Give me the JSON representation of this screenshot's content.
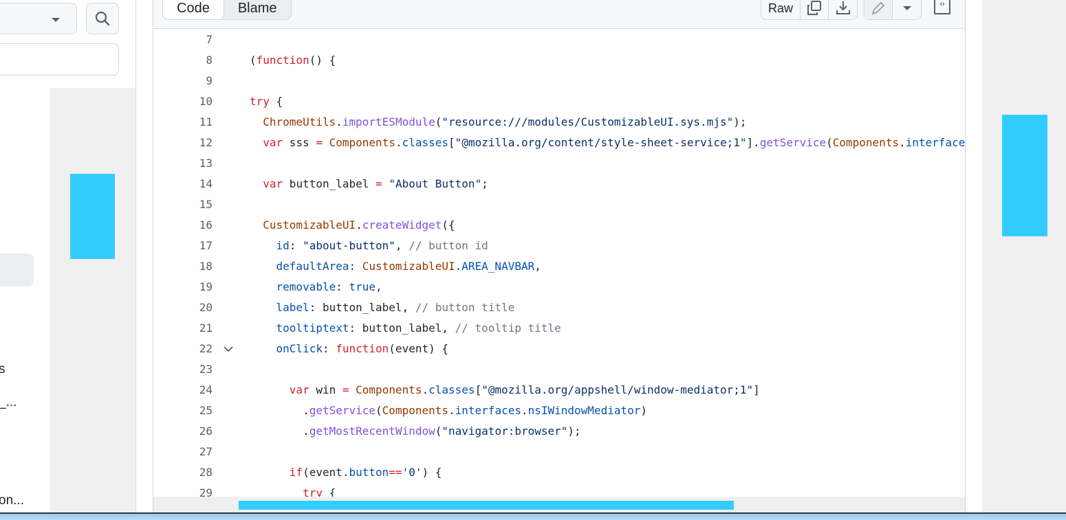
{
  "sidebar": {
    "truncated_items": [
      "s",
      "_...",
      "on..."
    ]
  },
  "tabs": [
    {
      "label": "Code",
      "active": true
    },
    {
      "label": "Blame",
      "active": false
    }
  ],
  "toolbar": {
    "raw_label": "Raw"
  },
  "colors": {
    "accent_overlay": "#33ccff",
    "keyword": "#cf222e",
    "entity": "#953800",
    "function": "#8250df",
    "constant": "#0550ae",
    "string": "#0a3069",
    "comment": "#6e7781"
  },
  "code": {
    "folded_line": 22,
    "lines": [
      {
        "n": "7",
        "t": []
      },
      {
        "n": "8",
        "t": [
          [
            "(",
            ""
          ],
          [
            "function",
            "k"
          ],
          [
            "() {",
            ""
          ]
        ]
      },
      {
        "n": "9",
        "t": []
      },
      {
        "n": "10",
        "t": [
          [
            "try",
            "k"
          ],
          [
            " {",
            ""
          ]
        ]
      },
      {
        "n": "11",
        "t": [
          [
            "  ",
            ""
          ],
          [
            "ChromeUtils",
            "e"
          ],
          [
            ".",
            ""
          ],
          [
            "importESModule",
            "f"
          ],
          [
            "(",
            ""
          ],
          [
            "\"resource:///modules/CustomizableUI.sys.mjs\"",
            "s"
          ],
          [
            ");",
            ""
          ]
        ]
      },
      {
        "n": "12",
        "t": [
          [
            "  ",
            ""
          ],
          [
            "var",
            "k"
          ],
          [
            " sss ",
            ""
          ],
          [
            "=",
            "k"
          ],
          [
            " ",
            ""
          ],
          [
            "Components",
            "e"
          ],
          [
            ".",
            ""
          ],
          [
            "classes",
            "c"
          ],
          [
            "[",
            ""
          ],
          [
            "\"@mozilla.org/content/style-sheet-service;1\"",
            "s"
          ],
          [
            "].",
            ""
          ],
          [
            "getService",
            "f"
          ],
          [
            "(",
            ""
          ],
          [
            "Components",
            "e"
          ],
          [
            ".",
            ""
          ],
          [
            "interfaces",
            "c"
          ]
        ]
      },
      {
        "n": "13",
        "t": []
      },
      {
        "n": "14",
        "t": [
          [
            "  ",
            ""
          ],
          [
            "var",
            "k"
          ],
          [
            " button_label ",
            ""
          ],
          [
            "=",
            "k"
          ],
          [
            " ",
            ""
          ],
          [
            "\"About Button\"",
            "s"
          ],
          [
            ";",
            ""
          ]
        ]
      },
      {
        "n": "15",
        "t": []
      },
      {
        "n": "16",
        "t": [
          [
            "  ",
            ""
          ],
          [
            "CustomizableUI",
            "e"
          ],
          [
            ".",
            ""
          ],
          [
            "createWidget",
            "f"
          ],
          [
            "({",
            ""
          ]
        ]
      },
      {
        "n": "17",
        "t": [
          [
            "    ",
            ""
          ],
          [
            "id",
            "c"
          ],
          [
            ": ",
            ""
          ],
          [
            "\"about-button\"",
            "s"
          ],
          [
            ", ",
            ""
          ],
          [
            "// button id",
            "m"
          ]
        ]
      },
      {
        "n": "18",
        "t": [
          [
            "    ",
            ""
          ],
          [
            "defaultArea",
            "c"
          ],
          [
            ": ",
            ""
          ],
          [
            "CustomizableUI",
            "e"
          ],
          [
            ".",
            ""
          ],
          [
            "AREA_NAVBAR",
            "c"
          ],
          [
            ",",
            ""
          ]
        ]
      },
      {
        "n": "19",
        "t": [
          [
            "    ",
            ""
          ],
          [
            "removable",
            "c"
          ],
          [
            ": ",
            ""
          ],
          [
            "true",
            "c"
          ],
          [
            ",",
            ""
          ]
        ]
      },
      {
        "n": "20",
        "t": [
          [
            "    ",
            ""
          ],
          [
            "label",
            "c"
          ],
          [
            ": button_label, ",
            ""
          ],
          [
            "// button title",
            "m"
          ]
        ]
      },
      {
        "n": "21",
        "t": [
          [
            "    ",
            ""
          ],
          [
            "tooltiptext",
            "c"
          ],
          [
            ": button_label, ",
            ""
          ],
          [
            "// tooltip title",
            "m"
          ]
        ]
      },
      {
        "n": "22",
        "t": [
          [
            "    ",
            ""
          ],
          [
            "onClick",
            "c"
          ],
          [
            ": ",
            ""
          ],
          [
            "function",
            "k"
          ],
          [
            "(event) {",
            ""
          ]
        ]
      },
      {
        "n": "23",
        "t": []
      },
      {
        "n": "24",
        "t": [
          [
            "      ",
            ""
          ],
          [
            "var",
            "k"
          ],
          [
            " win ",
            ""
          ],
          [
            "=",
            "k"
          ],
          [
            " ",
            ""
          ],
          [
            "Components",
            "e"
          ],
          [
            ".",
            ""
          ],
          [
            "classes",
            "c"
          ],
          [
            "[",
            ""
          ],
          [
            "\"@mozilla.org/appshell/window-mediator;1\"",
            "s"
          ],
          [
            "]",
            ""
          ]
        ]
      },
      {
        "n": "25",
        "t": [
          [
            "        .",
            ""
          ],
          [
            "getService",
            "f"
          ],
          [
            "(",
            ""
          ],
          [
            "Components",
            "e"
          ],
          [
            ".",
            ""
          ],
          [
            "interfaces",
            "c"
          ],
          [
            ".",
            ""
          ],
          [
            "nsIWindowMediator",
            "c"
          ],
          [
            ")",
            ""
          ]
        ]
      },
      {
        "n": "26",
        "t": [
          [
            "        .",
            ""
          ],
          [
            "getMostRecentWindow",
            "f"
          ],
          [
            "(",
            ""
          ],
          [
            "\"navigator:browser\"",
            "s"
          ],
          [
            ");",
            ""
          ]
        ]
      },
      {
        "n": "27",
        "t": []
      },
      {
        "n": "28",
        "t": [
          [
            "      ",
            ""
          ],
          [
            "if",
            "k"
          ],
          [
            "(event.",
            ""
          ],
          [
            "button",
            "c"
          ],
          [
            "==",
            "k"
          ],
          [
            "'0'",
            "s"
          ],
          [
            ") {",
            ""
          ]
        ]
      },
      {
        "n": "29",
        "t": [
          [
            "        ",
            ""
          ],
          [
            "try",
            "k"
          ],
          [
            " {",
            ""
          ]
        ]
      }
    ]
  },
  "scrollbar": {
    "horizontal_position": 0.0,
    "visible_fraction": 0.62
  }
}
